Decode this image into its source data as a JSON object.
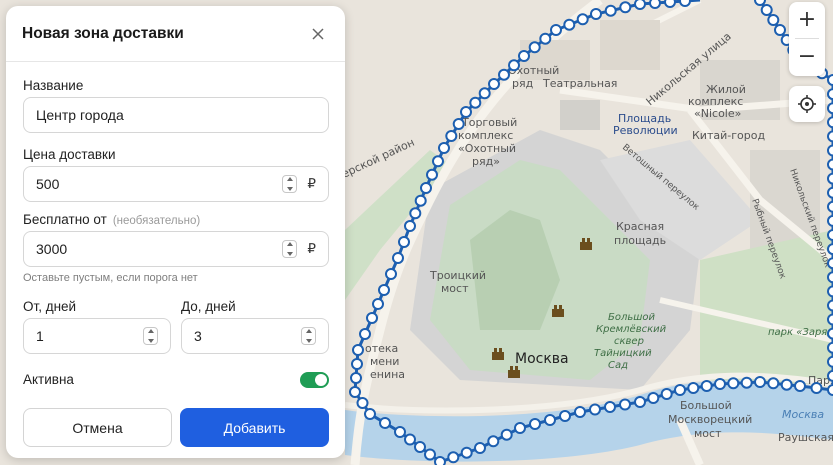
{
  "panel": {
    "title": "Новая зона доставки",
    "name_label": "Название",
    "name_value": "Центр города",
    "price_label": "Цена доставки",
    "price_value": "500",
    "free_label": "Бесплатно от",
    "free_optional": "(необязательно)",
    "free_value": "3000",
    "free_hint": "Оставьте пустым, если порога нет",
    "from_label": "От, дней",
    "from_value": "1",
    "to_label": "До, дней",
    "to_value": "3",
    "active_label": "Активна",
    "active": true,
    "currency": "₽",
    "cancel_label": "Отмена",
    "add_label": "Добавить"
  },
  "map": {
    "labels": {
      "moskva": "Москва",
      "teatralnaya": "Театральная",
      "ploshchad": "Площадь",
      "revolyutsii": "Революции",
      "kitay_gorod": "Китай-город",
      "krasnaya": "Красная",
      "ploshchad2": "площадь",
      "troitskiy": "Троицкий",
      "most": "мост",
      "bolshoy": "Большой",
      "moskvoretskiy": "Москворецкий",
      "most2": "мост",
      "park": "парк «Заряд",
      "moskva_river": "Москва",
      "rausheskaya": "Раушская на",
      "tayninsky1": "Большой",
      "tayninsky2": "Кремлёвский",
      "tayninsky3": "сквер",
      "tayninsky4": "Тайницкий",
      "tayninsky5": "Сад",
      "okhotny1": "Торговый",
      "okhotny2": "комплекс",
      "okhotny3": "«Охотный",
      "okhotny4": "ряд»",
      "nikolskaya": "Никольская улица",
      "zhiloy1": "Жилой",
      "zhiloy2": "комплекс",
      "zhiloy3": "«Nicole»",
      "ryad": "ряд",
      "okhotny_top": "Охотный",
      "vetoshny": "Ветошный переулок",
      "nikolsky_per": "Никольский переулок",
      "rybny": "Рыбный переулок",
      "biblioteka1": "отека",
      "biblioteka2": "мени",
      "biblioteka3": "енина",
      "rayon": "ерской район",
      "parya": "Паря",
      "bolsh_kreml": "Большой Кремлёвский сквер"
    },
    "zoom_in": "+",
    "zoom_out": "−"
  },
  "colors": {
    "accent": "#1f5fe0",
    "toggle_on": "#1f9d55",
    "zone_stroke": "#1d5fb0"
  }
}
